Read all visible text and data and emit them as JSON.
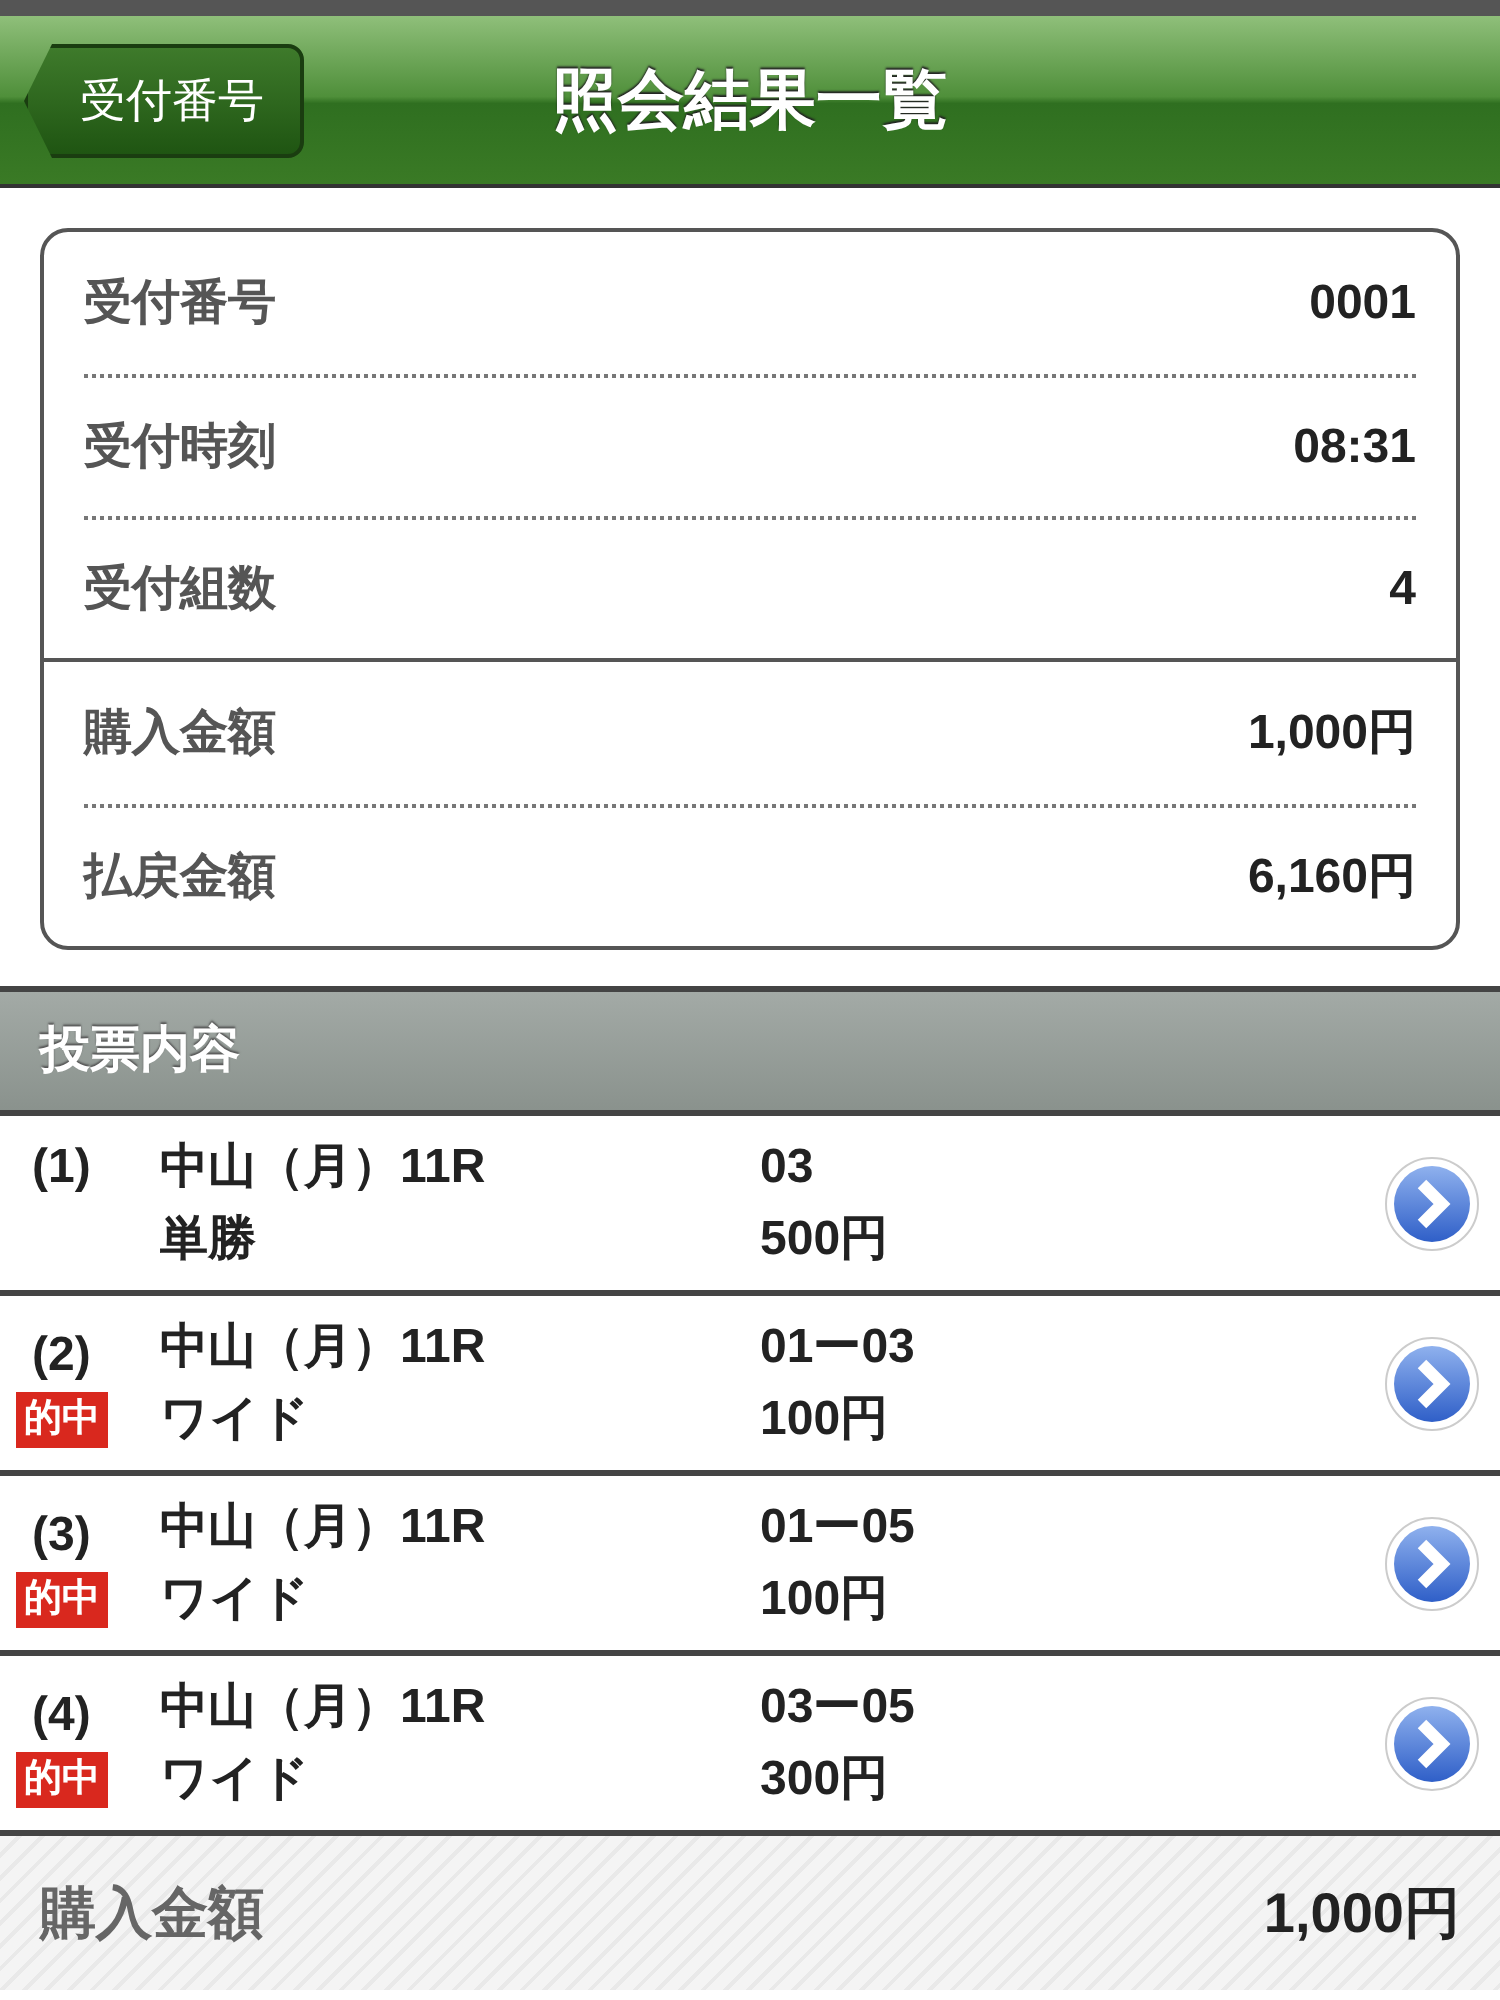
{
  "header": {
    "back_button": "受付番号",
    "title": "照会結果一覧"
  },
  "summary": {
    "groups": [
      [
        {
          "label": "受付番号",
          "value": "0001"
        },
        {
          "label": "受付時刻",
          "value": "08:31"
        },
        {
          "label": "受付組数",
          "value": "4"
        }
      ],
      [
        {
          "label": "購入金額",
          "value": "1,000円"
        },
        {
          "label": "払戻金額",
          "value": "6,160円"
        }
      ]
    ]
  },
  "section_title": "投票内容",
  "bets": [
    {
      "number": "(1)",
      "race": "中山（月）11R",
      "bet_type": "単勝",
      "combination": "03",
      "amount": "500円"
    },
    {
      "number": "(2)",
      "race": "中山（月）11R",
      "bet_type": "ワイド",
      "combination": "01ー03",
      "amount": "100円",
      "badge": "的中"
    },
    {
      "number": "(3)",
      "race": "中山（月）11R",
      "bet_type": "ワイド",
      "combination": "01ー05",
      "amount": "100円",
      "badge": "的中"
    },
    {
      "number": "(4)",
      "race": "中山（月）11R",
      "bet_type": "ワイド",
      "combination": "03ー05",
      "amount": "300円",
      "badge": "的中"
    }
  ],
  "footer": {
    "label": "購入金額",
    "value": "1,000円"
  }
}
